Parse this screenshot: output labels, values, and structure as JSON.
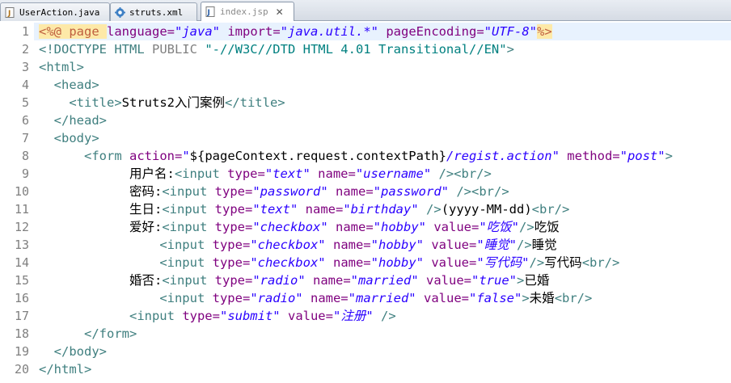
{
  "tabs": [
    {
      "label": "UserAction.java",
      "icon": "java-file-icon",
      "active": false,
      "closable": false
    },
    {
      "label": "struts.xml",
      "icon": "gear-icon",
      "active": false,
      "closable": false
    },
    {
      "label": "index.jsp",
      "icon": "jsp-file-icon",
      "active": true,
      "closable": true,
      "close_glyph": "✕"
    }
  ],
  "editor": {
    "current_line": 1,
    "lines": [
      {
        "number": "1",
        "tokens": [
          {
            "t": "dir",
            "v": "<%@ "
          },
          {
            "t": "dir",
            "v": "page "
          },
          {
            "t": "attr",
            "v": "language="
          },
          {
            "t": "str",
            "v": "\"java\""
          },
          {
            "t": "text",
            "v": " "
          },
          {
            "t": "attr",
            "v": "import="
          },
          {
            "t": "str",
            "v": "\"java.util.*\""
          },
          {
            "t": "text",
            "v": " "
          },
          {
            "t": "attr",
            "v": "pageEncoding="
          },
          {
            "t": "str",
            "v": "\"UTF-8\""
          },
          {
            "t": "dir",
            "v": "%>"
          }
        ]
      },
      {
        "number": "2",
        "tokens": [
          {
            "t": "tag",
            "v": "<!DOCTYPE HTML "
          },
          {
            "t": "grey",
            "v": "PUBLIC "
          },
          {
            "t": "doctype",
            "v": "\"-//W3C//DTD HTML 4.01 Transitional//EN\""
          },
          {
            "t": "tag",
            "v": ">"
          }
        ]
      },
      {
        "number": "3",
        "tokens": [
          {
            "t": "tag",
            "v": "<html>"
          }
        ]
      },
      {
        "number": "4",
        "tokens": [
          {
            "t": "text",
            "v": "  "
          },
          {
            "t": "tag",
            "v": "<head>"
          }
        ]
      },
      {
        "number": "5",
        "tokens": [
          {
            "t": "text",
            "v": "    "
          },
          {
            "t": "tag",
            "v": "<title>"
          },
          {
            "t": "text",
            "v": "Struts2入门案例"
          },
          {
            "t": "tag",
            "v": "</title>"
          }
        ]
      },
      {
        "number": "6",
        "tokens": [
          {
            "t": "text",
            "v": "  "
          },
          {
            "t": "tag",
            "v": "</head>"
          }
        ]
      },
      {
        "number": "7",
        "tokens": [
          {
            "t": "text",
            "v": "  "
          },
          {
            "t": "tag",
            "v": "<body>"
          }
        ]
      },
      {
        "number": "8",
        "tokens": [
          {
            "t": "text",
            "v": "      "
          },
          {
            "t": "tag",
            "v": "<form "
          },
          {
            "t": "attr",
            "v": "action="
          },
          {
            "t": "str-plain",
            "v": "\""
          },
          {
            "t": "text",
            "v": "${pageContext.request.contextPath}"
          },
          {
            "t": "str",
            "v": "/regist.action\""
          },
          {
            "t": "text",
            "v": " "
          },
          {
            "t": "attr",
            "v": "method="
          },
          {
            "t": "str",
            "v": "\"post\""
          },
          {
            "t": "tag",
            "v": ">"
          }
        ]
      },
      {
        "number": "9",
        "tokens": [
          {
            "t": "text",
            "v": "            用户名:"
          },
          {
            "t": "tag",
            "v": "<input "
          },
          {
            "t": "attr",
            "v": "type="
          },
          {
            "t": "str",
            "v": "\"text\""
          },
          {
            "t": "text",
            "v": " "
          },
          {
            "t": "attr",
            "v": "name="
          },
          {
            "t": "str",
            "v": "\"username\""
          },
          {
            "t": "text",
            "v": " "
          },
          {
            "t": "tag",
            "v": "/><br/>"
          }
        ]
      },
      {
        "number": "10",
        "tokens": [
          {
            "t": "text",
            "v": "            密码:"
          },
          {
            "t": "tag",
            "v": "<input "
          },
          {
            "t": "attr",
            "v": "type="
          },
          {
            "t": "str",
            "v": "\"password\""
          },
          {
            "t": "text",
            "v": " "
          },
          {
            "t": "attr",
            "v": "name="
          },
          {
            "t": "str",
            "v": "\"password\""
          },
          {
            "t": "text",
            "v": " "
          },
          {
            "t": "tag",
            "v": "/><br/>"
          }
        ]
      },
      {
        "number": "11",
        "tokens": [
          {
            "t": "text",
            "v": "            生日:"
          },
          {
            "t": "tag",
            "v": "<input "
          },
          {
            "t": "attr",
            "v": "type="
          },
          {
            "t": "str",
            "v": "\"text\""
          },
          {
            "t": "text",
            "v": " "
          },
          {
            "t": "attr",
            "v": "name="
          },
          {
            "t": "str",
            "v": "\"birthday\""
          },
          {
            "t": "text",
            "v": " "
          },
          {
            "t": "tag",
            "v": "/>"
          },
          {
            "t": "text",
            "v": "(yyyy-MM-dd)"
          },
          {
            "t": "tag",
            "v": "<br/>"
          }
        ]
      },
      {
        "number": "12",
        "tokens": [
          {
            "t": "text",
            "v": "            爱好:"
          },
          {
            "t": "tag",
            "v": "<input "
          },
          {
            "t": "attr",
            "v": "type="
          },
          {
            "t": "str",
            "v": "\"checkbox\""
          },
          {
            "t": "text",
            "v": " "
          },
          {
            "t": "attr",
            "v": "name="
          },
          {
            "t": "str",
            "v": "\"hobby\""
          },
          {
            "t": "text",
            "v": " "
          },
          {
            "t": "attr",
            "v": "value="
          },
          {
            "t": "str",
            "v": "\"吃饭\""
          },
          {
            "t": "tag",
            "v": "/>"
          },
          {
            "t": "text",
            "v": "吃饭"
          }
        ]
      },
      {
        "number": "13",
        "tokens": [
          {
            "t": "text",
            "v": "                "
          },
          {
            "t": "tag",
            "v": "<input "
          },
          {
            "t": "attr",
            "v": "type="
          },
          {
            "t": "str",
            "v": "\"checkbox\""
          },
          {
            "t": "text",
            "v": " "
          },
          {
            "t": "attr",
            "v": "name="
          },
          {
            "t": "str",
            "v": "\"hobby\""
          },
          {
            "t": "text",
            "v": " "
          },
          {
            "t": "attr",
            "v": "value="
          },
          {
            "t": "str",
            "v": "\"睡觉\""
          },
          {
            "t": "tag",
            "v": "/>"
          },
          {
            "t": "text",
            "v": "睡觉"
          }
        ]
      },
      {
        "number": "14",
        "tokens": [
          {
            "t": "text",
            "v": "                "
          },
          {
            "t": "tag",
            "v": "<input "
          },
          {
            "t": "attr",
            "v": "type="
          },
          {
            "t": "str",
            "v": "\"checkbox\""
          },
          {
            "t": "text",
            "v": " "
          },
          {
            "t": "attr",
            "v": "name="
          },
          {
            "t": "str",
            "v": "\"hobby\""
          },
          {
            "t": "text",
            "v": " "
          },
          {
            "t": "attr",
            "v": "value="
          },
          {
            "t": "str",
            "v": "\"写代码\""
          },
          {
            "t": "tag",
            "v": "/>"
          },
          {
            "t": "text",
            "v": "写代码"
          },
          {
            "t": "tag",
            "v": "<br/>"
          }
        ]
      },
      {
        "number": "15",
        "tokens": [
          {
            "t": "text",
            "v": "            婚否:"
          },
          {
            "t": "tag",
            "v": "<input "
          },
          {
            "t": "attr",
            "v": "type="
          },
          {
            "t": "str",
            "v": "\"radio\""
          },
          {
            "t": "text",
            "v": " "
          },
          {
            "t": "attr",
            "v": "name="
          },
          {
            "t": "str",
            "v": "\"married\""
          },
          {
            "t": "text",
            "v": " "
          },
          {
            "t": "attr",
            "v": "value="
          },
          {
            "t": "str",
            "v": "\"true\""
          },
          {
            "t": "tag",
            "v": ">"
          },
          {
            "t": "text",
            "v": "已婚"
          }
        ]
      },
      {
        "number": "16",
        "tokens": [
          {
            "t": "text",
            "v": "                "
          },
          {
            "t": "tag",
            "v": "<input "
          },
          {
            "t": "attr",
            "v": "type="
          },
          {
            "t": "str",
            "v": "\"radio\""
          },
          {
            "t": "text",
            "v": " "
          },
          {
            "t": "attr",
            "v": "name="
          },
          {
            "t": "str",
            "v": "\"married\""
          },
          {
            "t": "text",
            "v": " "
          },
          {
            "t": "attr",
            "v": "value="
          },
          {
            "t": "str",
            "v": "\"false\""
          },
          {
            "t": "tag",
            "v": ">"
          },
          {
            "t": "text",
            "v": "未婚"
          },
          {
            "t": "tag",
            "v": "<br/>"
          }
        ]
      },
      {
        "number": "17",
        "tokens": [
          {
            "t": "text",
            "v": "            "
          },
          {
            "t": "tag",
            "v": "<input "
          },
          {
            "t": "attr",
            "v": "type="
          },
          {
            "t": "str",
            "v": "\"submit\""
          },
          {
            "t": "text",
            "v": " "
          },
          {
            "t": "attr",
            "v": "value="
          },
          {
            "t": "str",
            "v": "\"注册\""
          },
          {
            "t": "text",
            "v": " "
          },
          {
            "t": "tag",
            "v": "/>"
          }
        ]
      },
      {
        "number": "18",
        "tokens": [
          {
            "t": "text",
            "v": "      "
          },
          {
            "t": "tag",
            "v": "</form>"
          }
        ]
      },
      {
        "number": "19",
        "tokens": [
          {
            "t": "text",
            "v": "  "
          },
          {
            "t": "tag",
            "v": "</body>"
          }
        ]
      },
      {
        "number": "20",
        "tokens": [
          {
            "t": "tag",
            "v": "</html>"
          }
        ]
      }
    ]
  },
  "colors": {
    "tag": "#3f7f7f",
    "attribute": "#7f007f",
    "string": "#2a00ff",
    "directive": "#bf5f3f",
    "directive_background": "#fde9a8",
    "line_number": "#808080",
    "current_line_highlight": "#e8f2fe"
  }
}
